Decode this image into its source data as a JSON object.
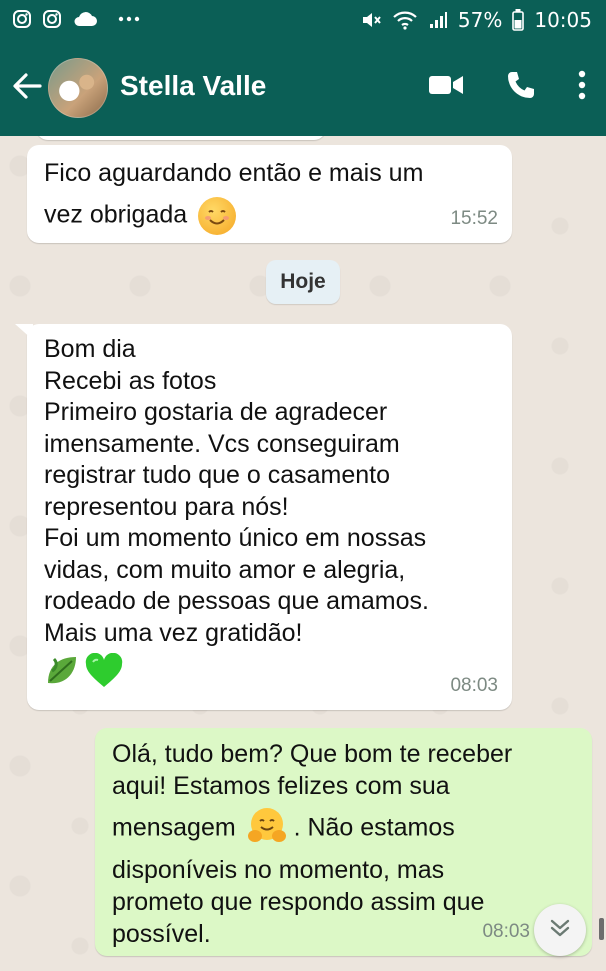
{
  "status": {
    "time": "10:05",
    "battery": "57%"
  },
  "header": {
    "contact_name": "Stella Valle"
  },
  "date_separator": "Hoje",
  "messages": [
    {
      "direction": "incoming",
      "lines": [
        "Fico aguardando então e mais um",
        "vez obrigada"
      ],
      "emoji": "smiling-face-icon",
      "time": "15:52"
    },
    {
      "direction": "incoming",
      "lines": [
        "Bom dia",
        "Recebi as fotos",
        "Primeiro gostaria de agradecer",
        "imensamente. Vcs conseguiram",
        "registrar tudo que o casamento",
        "representou para nós!",
        "Foi um momento único em nossas",
        "vidas, com muito amor e alegria,",
        "rodeado de pessoas que amamos.",
        "Mais uma vez gratidão!"
      ],
      "emoji": "leaf-and-green-heart-icons",
      "time": "08:03"
    },
    {
      "direction": "outgoing",
      "lines": [
        "Olá, tudo bem? Que bom te receber",
        "aqui! Estamos felizes com sua",
        "mensagem",
        ". Não estamos",
        "disponíveis no momento, mas",
        "prometo que respondo assim que",
        "possível."
      ],
      "emoji": "hugging-face-icon",
      "time": "08:03"
    }
  ],
  "colors": {
    "header": "#0b5f56",
    "chat_bg": "#ece5dd",
    "incoming": "#ffffff",
    "outgoing": "#dcf8c6"
  }
}
